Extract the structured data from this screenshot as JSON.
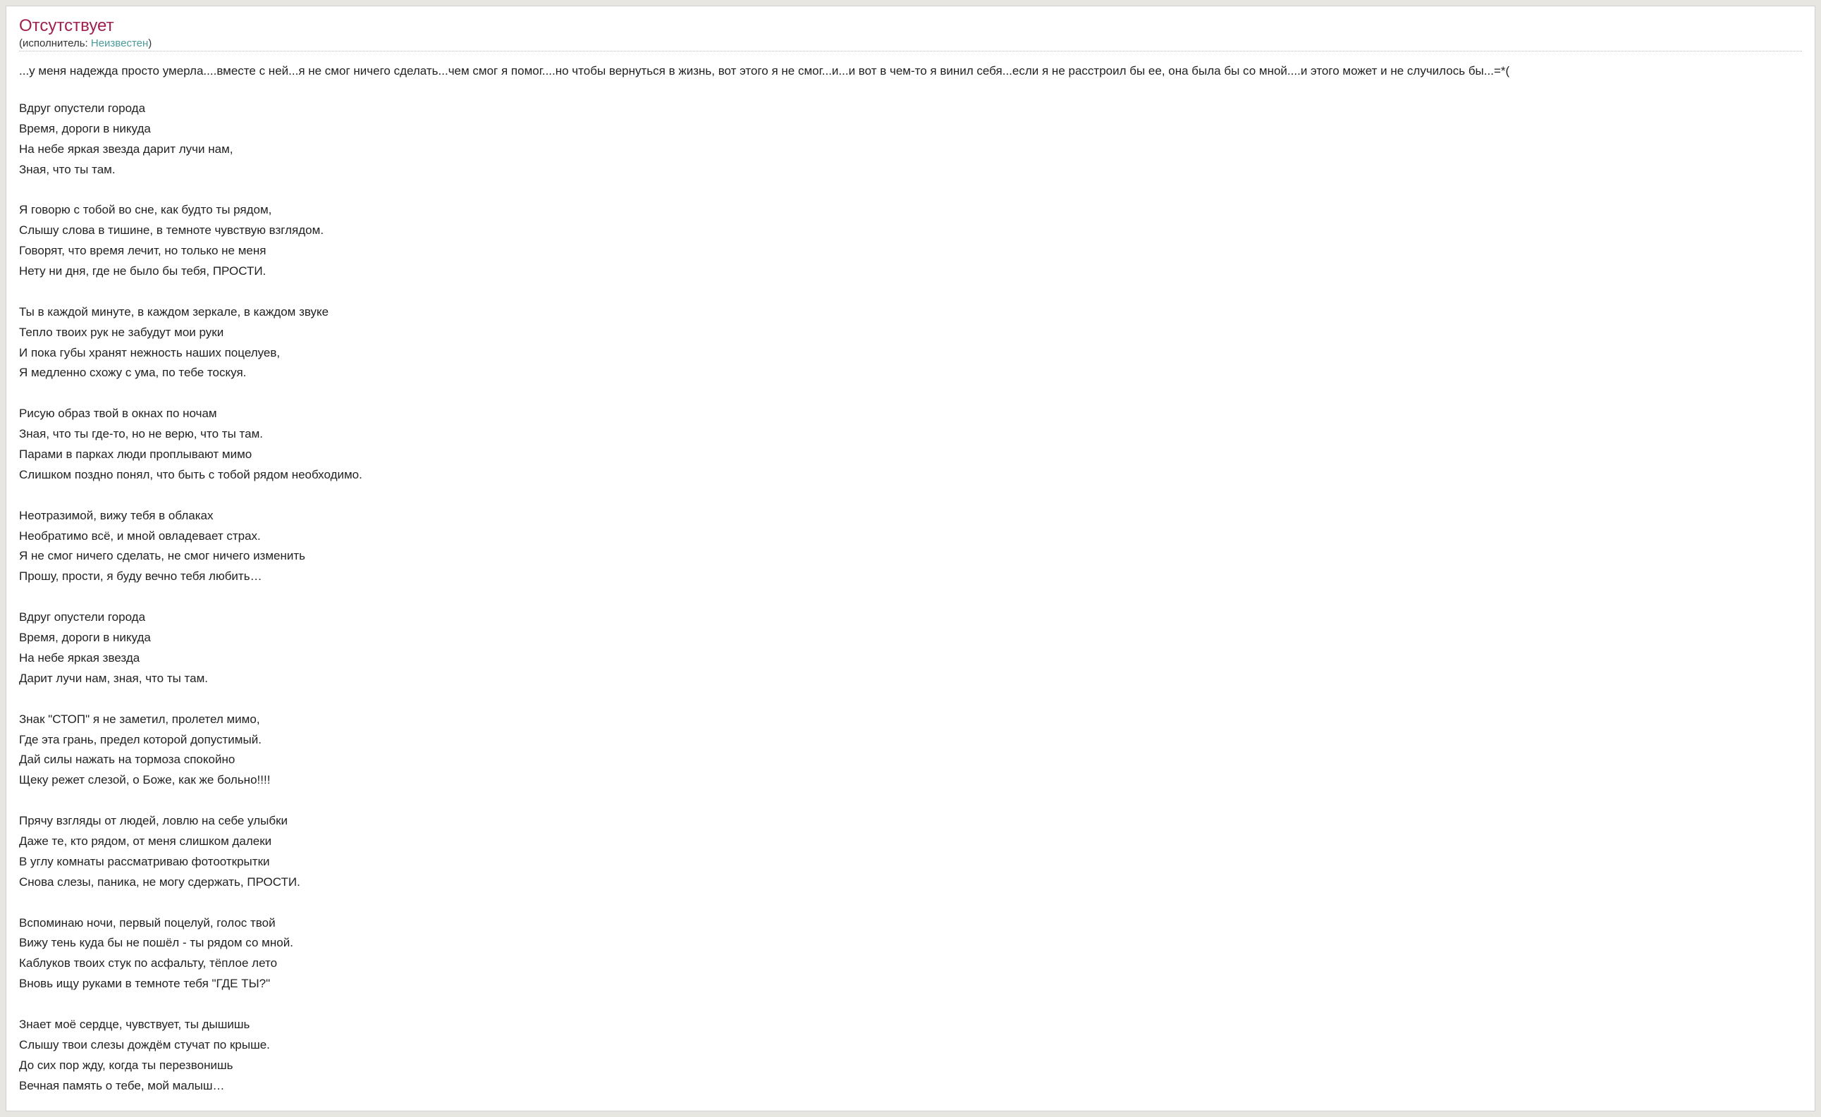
{
  "header": {
    "title": "Отсутствует",
    "meta_prefix": "(исполнитель: ",
    "artist": "Неизвестен",
    "meta_suffix": ")"
  },
  "quote": "...у меня надежда просто умерла....вместе с ней...я не смог ничего сделать...чем смог я помог....но чтобы вернуться в жизнь, вот этого я не смог...и...и вот в чем-то я винил себя...если  я не расстроил бы ее, она была бы со мной....и этого может и не случилось бы...=*(",
  "lyrics": "Вдруг опустели города\nВремя, дороги в никуда\nНа небе яркая звезда дарит лучи нам,\nЗная, что ты там.\n\nЯ говорю с тобой во сне, как будто ты рядом,\nСлышу слова в тишине, в темноте чувствую взглядом.\nГоворят, что время лечит, но только не меня\nНету ни дня, где не было бы тебя, ПРОСТИ.\n\nТы в каждой минуте, в каждом зеркале, в каждом звуке\nТепло твоих рук не забудут мои руки\nИ пока губы хранят нежность наших поцелуев,\nЯ медленно схожу с ума, по тебе тоскуя.\n\nРисую образ твой в окнах по ночам\nЗная, что ты где-то, но не верю, что ты там.\nПарами в парках люди проплывают мимо\nСлишком поздно понял, что быть с тобой рядом необходимо.\n\nНеотразимой, вижу тебя в облаках\nНеобратимо всё, и мной овладевает страх.\nЯ не смог ничего сделать, не смог ничего изменить\nПрошу, прости, я буду вечно тебя любить…\n\nВдруг опустели города\nВремя, дороги в никуда\nНа небе яркая звезда\nДарит лучи нам, зная, что ты там.\n\nЗнак \"СТОП\" я не заметил, пролетел мимо,\nГде эта грань, предел которой допустимый.\nДай силы нажать на тормоза спокойно\nЩеку режет слезой, о Боже, как же больно!!!!\n\nПрячу взгляды от людей, ловлю на себе улыбки\nДаже те, кто рядом, от меня слишком далеки\nВ углу комнаты рассматриваю фотооткрытки\nСнова слезы, паника, не могу сдержать, ПРОСТИ.\n\nВспоминаю ночи, первый поцелуй, голос твой\nВижу тень куда бы не пошёл - ты рядом со мной.\nКаблуков твоих стук по асфальту, тёплое лето\nВновь ищу руками в темноте тебя \"ГДЕ ТЫ?\"\n\nЗнает моё сердце, чувствует, ты дышишь\nСлышу твои слезы дождём стучат по крыше.\nДо сих пор жду, когда ты перезвонишь\nВечная память о тебе, мой малыш…"
}
